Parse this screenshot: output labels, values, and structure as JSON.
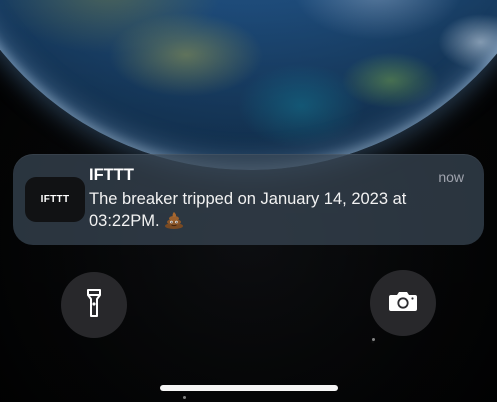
{
  "notification": {
    "app_name": "IFTTT",
    "app_icon_text": "IFTTT",
    "time": "now",
    "message": "The breaker tripped on January 14, 2023 at 03:22PM.",
    "emoji_icon": "pile-of-poo"
  },
  "quick_actions": {
    "left_icon": "flashlight-icon",
    "right_icon": "camera-icon"
  },
  "colors": {
    "notification_bg": "#3a4856",
    "button_bg": "#2c2c30",
    "home_indicator": "#f5f5f5"
  }
}
